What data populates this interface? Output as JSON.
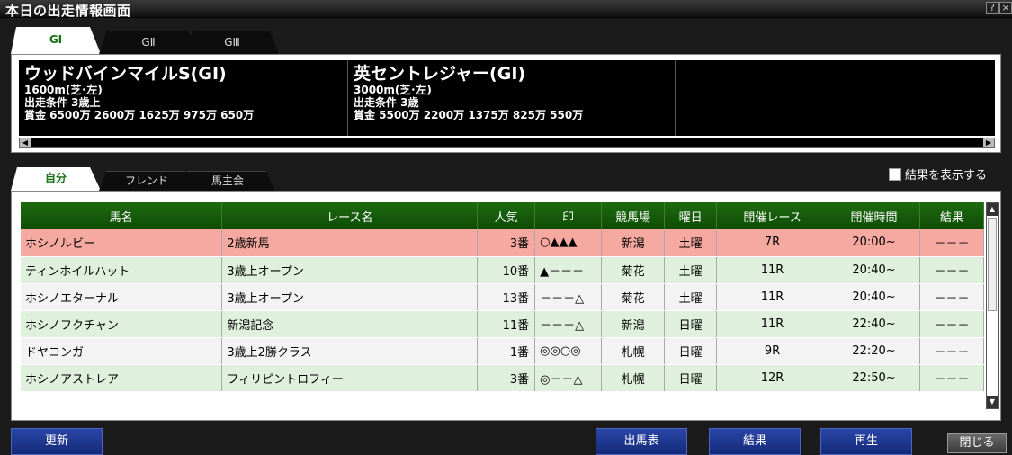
{
  "window": {
    "title": "本日の出走情報画面",
    "help_label": "?",
    "close_label": "×"
  },
  "grade_tabs": [
    {
      "label": "GⅠ",
      "active": true
    },
    {
      "label": "GⅡ",
      "active": false
    },
    {
      "label": "GⅢ",
      "active": false
    }
  ],
  "races": [
    {
      "name": "ウッドバインマイルS(GⅠ)",
      "distance": "1600m(芝･左)",
      "condition": "出走条件 3歳上",
      "prize": "賞金  6500万 2600万 1625万 975万 650万"
    },
    {
      "name": "英セントレジャー(GⅠ)",
      "distance": "3000m(芝･左)",
      "condition": "出走条件 3歳",
      "prize": "賞金  5500万 2200万 1375万 825万 550万"
    }
  ],
  "owner_tabs": [
    {
      "label": "自分",
      "active": true
    },
    {
      "label": "フレンド",
      "active": false
    },
    {
      "label": "馬主会",
      "active": false
    }
  ],
  "show_results": {
    "label": "結果を表示する",
    "checked": false
  },
  "table": {
    "headers": [
      "馬名",
      "レース名",
      "人気",
      "印",
      "競馬場",
      "曜日",
      "開催レース",
      "開催時間",
      "結果"
    ],
    "rows": [
      [
        "ホシノルビー",
        "2歳新馬",
        "3番",
        "○▲▲▲",
        "新潟",
        "土曜",
        "7R",
        "20:00~",
        "－－－"
      ],
      [
        "ティンホイルハット",
        "3歳上オープン",
        "10番",
        "▲－－－",
        "菊花",
        "土曜",
        "11R",
        "20:40~",
        "－－－"
      ],
      [
        "ホシノエターナル",
        "3歳上オープン",
        "13番",
        "－－－△",
        "菊花",
        "土曜",
        "11R",
        "20:40~",
        "－－－"
      ],
      [
        "ホシノフクチャン",
        "新潟記念",
        "11番",
        "－－－△",
        "新潟",
        "日曜",
        "11R",
        "22:40~",
        "－－－"
      ],
      [
        "ドヤコンガ",
        "3歳上2勝クラス",
        "1番",
        "◎◎○◎",
        "札幌",
        "日曜",
        "9R",
        "22:20~",
        "－－－"
      ],
      [
        "ホシノアストレア",
        "フィリピントロフィー",
        "3番",
        "◎－－△",
        "札幌",
        "日曜",
        "12R",
        "22:50~",
        "－－－"
      ]
    ]
  },
  "buttons": {
    "update": "更新",
    "entries": "出馬表",
    "results": "結果",
    "replay": "再生",
    "close": "閉じる"
  },
  "colors": {
    "header_green": "#0e4c06",
    "highlight_row": "#f5a9a0",
    "button_blue": "#1c3890"
  }
}
